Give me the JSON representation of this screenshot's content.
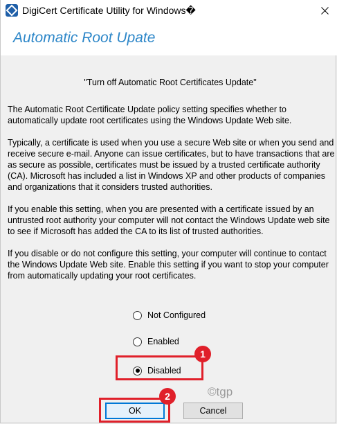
{
  "window": {
    "title": "DigiCert Certificate Utility for Windows\u0000",
    "title_display": "DigiCert Certificate Utility for Windows�",
    "close_label": "✕"
  },
  "header": {
    "title": "Automatic Root Upate"
  },
  "policy": {
    "heading": "\"Turn off Automatic Root Certificates Update\"",
    "paragraphs": [
      "The Automatic Root Certificate Update policy setting specifies whether to automatically update root certificates using the Windows Update Web site.",
      "Typically, a certificate is used when you use a secure Web site or when you send and receive secure e-mail. Anyone can issue certificates, but to have transactions that are as secure as possible, certificates must be issued by a trusted certificate authority (CA). Microsoft has included a list in Windows XP and other products of companies and organizations that it considers trusted authorities.",
      "If you enable this setting, when you are presented with a certificate issued by an untrusted root authority your computer will not contact the Windows Update web site to see if Microsoft has added the CA to its list of trusted authorities.",
      "If you disable or do not configure this setting, your computer will continue to contact the Windows Update Web site.  Enable this setting if you want to stop your computer from automatically updating your root certificates."
    ]
  },
  "options": [
    {
      "label": "Not Configured",
      "checked": false
    },
    {
      "label": "Enabled",
      "checked": false
    },
    {
      "label": "Disabled",
      "checked": true
    }
  ],
  "buttons": {
    "ok": "OK",
    "cancel": "Cancel"
  },
  "annotations": {
    "step1": "1",
    "step2": "2",
    "highlight_color": "#e0202a"
  },
  "watermark": "©tgp",
  "colors": {
    "header_title": "#2c86c8",
    "accent_border": "#0078d7"
  },
  "icons": {
    "app": "digicert-app-icon",
    "close": "close-icon"
  }
}
